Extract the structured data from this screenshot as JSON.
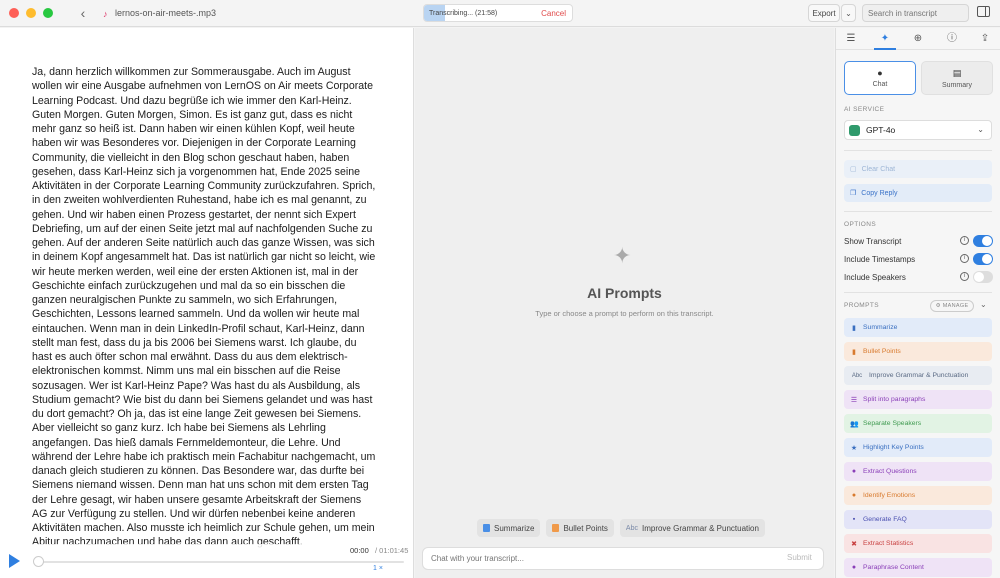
{
  "titlebar": {
    "back_icon": "chevron-left-icon",
    "file_name": "lernos-on-air-meets-.mp3",
    "transcribing_label": "Transcribing... (21:58)",
    "transcribing_progress": 0.14,
    "cancel_label": "Cancel",
    "export_label": "Export",
    "search_placeholder": "Search in transcript"
  },
  "transcript": {
    "text": "Ja, dann herzlich willkommen zur Sommerausgabe. Auch im August wollen wir eine Ausgabe aufnehmen von LernOS on Air meets Corporate Learning Podcast. Und dazu begrüße ich wie immer den Karl-Heinz. Guten Morgen. Guten Morgen, Simon. Es ist ganz gut, dass es nicht mehr ganz so heiß ist. Dann haben wir einen kühlen Kopf, weil heute haben wir was Besonderes vor. Diejenigen in der Corporate Learning Community, die vielleicht in den Blog schon geschaut haben, haben gesehen, dass Karl-Heinz sich ja vorgenommen hat, Ende 2025 seine Aktivitäten in der Corporate Learning Community zurückzufahren. Sprich, in den zweiten wohlverdienten Ruhestand, habe ich es mal genannt, zu gehen. Und wir haben einen Prozess gestartet, der nennt sich Expert Debriefing, um auf der einen Seite jetzt mal auf nachfolgenden Suche zu gehen. Auf der anderen Seite natürlich auch das ganze Wissen, was sich in deinem Kopf angesammelt hat. Das ist natürlich gar nicht so leicht, wie wir heute merken werden, weil eine der ersten Aktionen ist, mal in der Geschichte einfach zurückzugehen und mal da so ein bisschen die ganzen neuralgischen Punkte zu sammeln, wo sich Erfahrungen, Geschichten, Lessons learned sammeln. Und da wollen wir heute mal eintauchen. Wenn man in dein LinkedIn-Profil schaut, Karl-Heinz, dann stellt man fest, dass du ja bis 2006 bei Siemens warst. Ich glaube, du hast es auch öfter schon mal erwähnt. Dass du aus dem elektrisch-elektronischen kommst. Nimm uns mal ein bisschen auf die Reise sozusagen. Wer ist Karl-Heinz Pape? Was hast du als Ausbildung, als Studium gemacht? Wie bist du dann bei Siemens gelandet und was hast du dort gemacht? Oh ja, das ist eine lange Zeit gewesen bei Siemens. Aber vielleicht so ganz kurz. Ich habe bei Siemens als Lehrling angefangen. Das hieß damals Fernmeldemonteur, die Lehre. Und während der Lehre habe ich praktisch mein Fachabitur nachgemacht, um danach gleich studieren zu können. Das Besondere war, das durfte bei Siemens niemand wissen. Denn man hat uns schon mit dem ersten Tag der Lehre gesagt, wir haben unsere gesamte Arbeitskraft der Siemens AG zur Verfügung zu stellen. Und wir dürfen nebenbei keine anderen Aktivitäten machen. Also musste ich heimlich zur Schule gehen, um mein Abitur nachzumachen und habe das dann auch geschafft."
  },
  "player": {
    "current_time": "00:00",
    "total_time": "/ 01:01:45",
    "speed": "1 ×",
    "position": 0.0
  },
  "middle": {
    "title": "AI Prompts",
    "subtitle": "Type or choose a prompt to perform on this transcript.",
    "quick_prompts": [
      {
        "label": "Summarize",
        "color": "#4a8fe6",
        "icon": "document-icon"
      },
      {
        "label": "Bullet Points",
        "color": "#f09a4a",
        "icon": "list-icon"
      },
      {
        "label": "Improve Grammar & Punctuation",
        "color": "#7a8aa8",
        "icon": "abc-icon"
      }
    ],
    "chat_placeholder": "Chat with your transcript...",
    "submit_label": "Submit"
  },
  "sidebar": {
    "tabs": [
      "list-icon",
      "sparkle-icon",
      "translate-icon",
      "info-icon",
      "share-icon"
    ],
    "active_tab": 1,
    "modes": {
      "chat": "Chat",
      "summary": "Summary"
    },
    "ai_service_label": "AI SERVICE",
    "model": "GPT-4o",
    "clear_chat": "Clear Chat",
    "copy_reply": "Copy Reply",
    "options_label": "OPTIONS",
    "options": [
      {
        "label": "Show Transcript",
        "on": true
      },
      {
        "label": "Include Timestamps",
        "on": true
      },
      {
        "label": "Include Speakers",
        "on": false
      }
    ],
    "prompts_label": "PROMPTS",
    "manage_label": "MANAGE",
    "prompts": [
      {
        "label": "Summarize",
        "bg": "#e2ebf9",
        "fg": "#3a6fc0",
        "icon": "document-icon"
      },
      {
        "label": "Bullet Points",
        "bg": "#fae9dc",
        "fg": "#d87a2e",
        "icon": "list-icon"
      },
      {
        "label": "Improve Grammar & Punctuation",
        "bg": "#e8ecf2",
        "fg": "#5a6a84",
        "icon": "abc-icon"
      },
      {
        "label": "Split into paragraphs",
        "bg": "#efe3f6",
        "fg": "#8a3fb8",
        "icon": "paragraph-icon"
      },
      {
        "label": "Separate Speakers",
        "bg": "#e2f3e4",
        "fg": "#3f9a50",
        "icon": "people-icon"
      },
      {
        "label": "Highlight Key Points",
        "bg": "#e2ebf9",
        "fg": "#3a6fc0",
        "icon": "star-icon"
      },
      {
        "label": "Extract Questions",
        "bg": "#efe3f6",
        "fg": "#8a3fb8",
        "icon": "question-icon"
      },
      {
        "label": "Identify Emotions",
        "bg": "#fae9dc",
        "fg": "#d87a2e",
        "icon": "emotion-icon"
      },
      {
        "label": "Generate FAQ",
        "bg": "#e3e4f7",
        "fg": "#4a4fb0",
        "icon": "faq-icon"
      },
      {
        "label": "Extract Statistics",
        "bg": "#f9e3e3",
        "fg": "#c84040",
        "icon": "stats-icon"
      },
      {
        "label": "Paraphrase Content",
        "bg": "#efe3f6",
        "fg": "#8a3fb8",
        "icon": "paraphrase-icon"
      }
    ]
  }
}
